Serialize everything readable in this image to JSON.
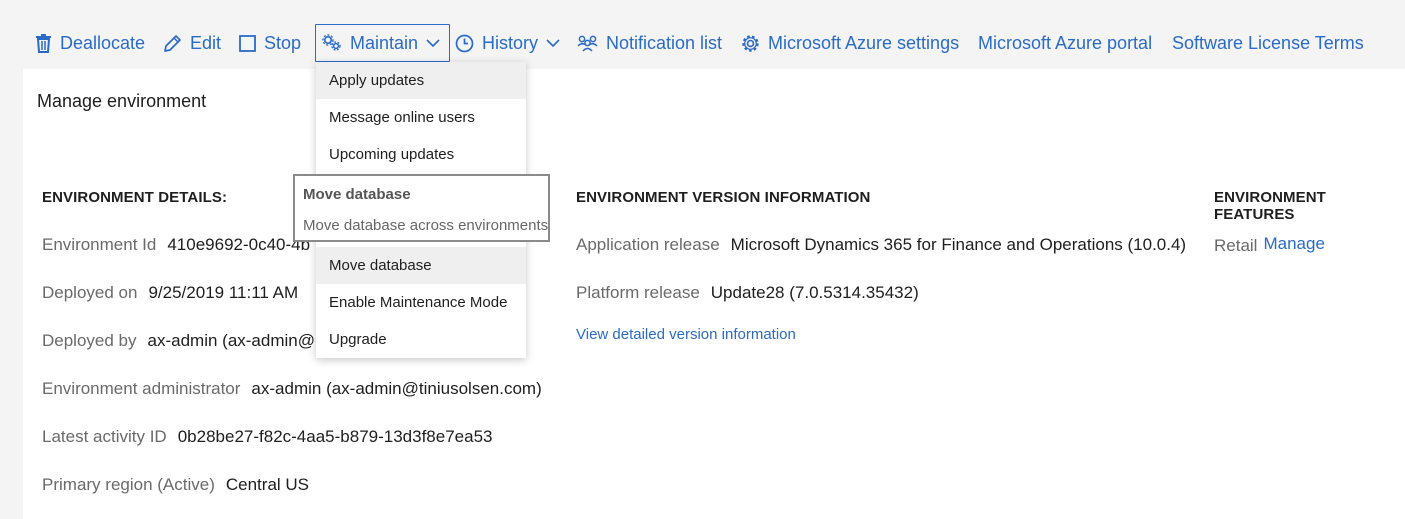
{
  "toolbar": {
    "deallocate": "Deallocate",
    "edit": "Edit",
    "stop": "Stop",
    "maintain": "Maintain",
    "history": "History",
    "notification_list": "Notification list",
    "azure_settings": "Microsoft Azure settings",
    "azure_portal": "Microsoft Azure portal",
    "license_terms": "Software License Terms"
  },
  "maintain_menu": {
    "items": [
      "Apply updates",
      "Message online users",
      "Upcoming updates",
      "Move database",
      "Enable Maintenance Mode",
      "Upgrade"
    ],
    "hovered_index": 0
  },
  "tooltip": {
    "title": "Move database",
    "description": "Move database across environments"
  },
  "panel": {
    "title": "Manage environment",
    "details": {
      "heading": "ENVIRONMENT DETAILS:",
      "rows": [
        {
          "label": "Environment Id",
          "value": "410e9692-0c40-4b"
        },
        {
          "label": "Deployed on",
          "value": "9/25/2019 11:11 AM"
        },
        {
          "label": "Deployed by",
          "value": "ax-admin (ax-admin@"
        },
        {
          "label": "Environment administrator",
          "value": "ax-admin (ax-admin@tiniusolsen.com)"
        },
        {
          "label": "Latest activity ID",
          "value": "0b28be27-f82c-4aa5-b879-13d3f8e7ea53"
        },
        {
          "label": "Primary region (Active)",
          "value": "Central US"
        }
      ]
    },
    "version": {
      "heading": "ENVIRONMENT VERSION INFORMATION",
      "rows": [
        {
          "label": "Application release",
          "value": "Microsoft Dynamics 365 for Finance and Operations (10.0.4)"
        },
        {
          "label": "Platform release",
          "value": "Update28 (7.0.5314.35432)"
        }
      ],
      "detail_link": "View detailed version information"
    },
    "features": {
      "heading": "ENVIRONMENT FEATURES",
      "label": "Retail",
      "link": "Manage"
    }
  },
  "colors": {
    "accent": "#2a6bc8",
    "text": "#1e1e1e",
    "muted": "#6a6a6a",
    "background": "#f4f4f4",
    "panel": "#ffffff"
  },
  "icons": [
    "trash-icon",
    "pencil-icon",
    "stop-square-icon",
    "gears-icon",
    "chevron-down-icon",
    "clock-icon",
    "people-icon",
    "gear-icon"
  ]
}
